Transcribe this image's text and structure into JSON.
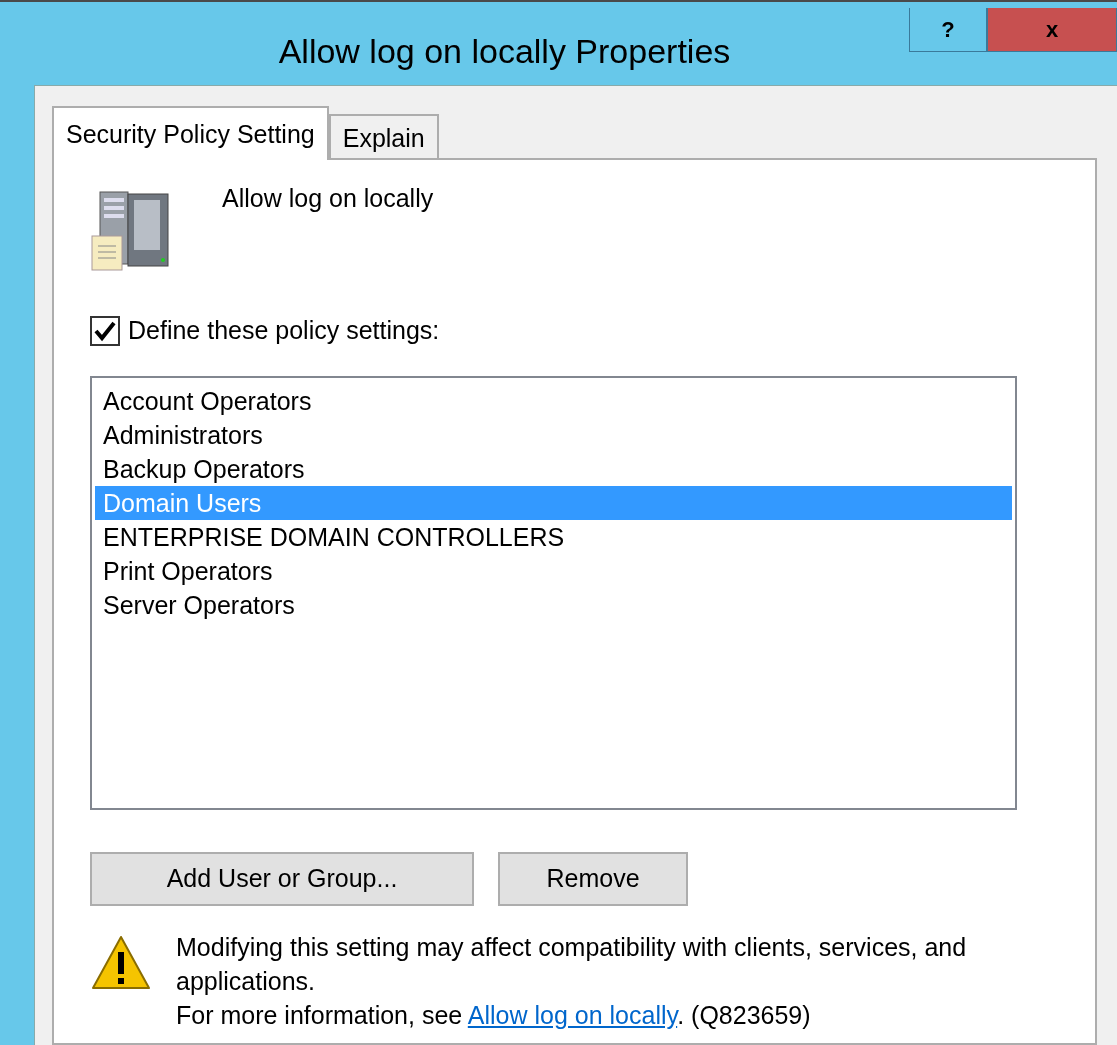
{
  "window": {
    "title": "Allow log on locally Properties",
    "help_button": "?",
    "close_button": "x"
  },
  "tabs": [
    {
      "label": "Security Policy Setting",
      "selected": true
    },
    {
      "label": "Explain",
      "selected": false
    }
  ],
  "policy_name": "Allow log on locally",
  "define_checkbox": {
    "label": "Define these policy settings:",
    "checked": true
  },
  "members": [
    {
      "name": "Account Operators",
      "selected": false
    },
    {
      "name": "Administrators",
      "selected": false
    },
    {
      "name": "Backup Operators",
      "selected": false
    },
    {
      "name": "Domain Users",
      "selected": true
    },
    {
      "name": "ENTERPRISE DOMAIN CONTROLLERS",
      "selected": false
    },
    {
      "name": "Print Operators",
      "selected": false
    },
    {
      "name": "Server Operators",
      "selected": false
    }
  ],
  "buttons": [
    "Add User or Group...",
    "Remove"
  ],
  "warning": {
    "message": "Modifying this setting may affect compatibility with clients, services, and applications.",
    "info_prefix": "For more information, see ",
    "link": "Allow log on locally",
    "info_suffix": ". (Q823659)"
  }
}
